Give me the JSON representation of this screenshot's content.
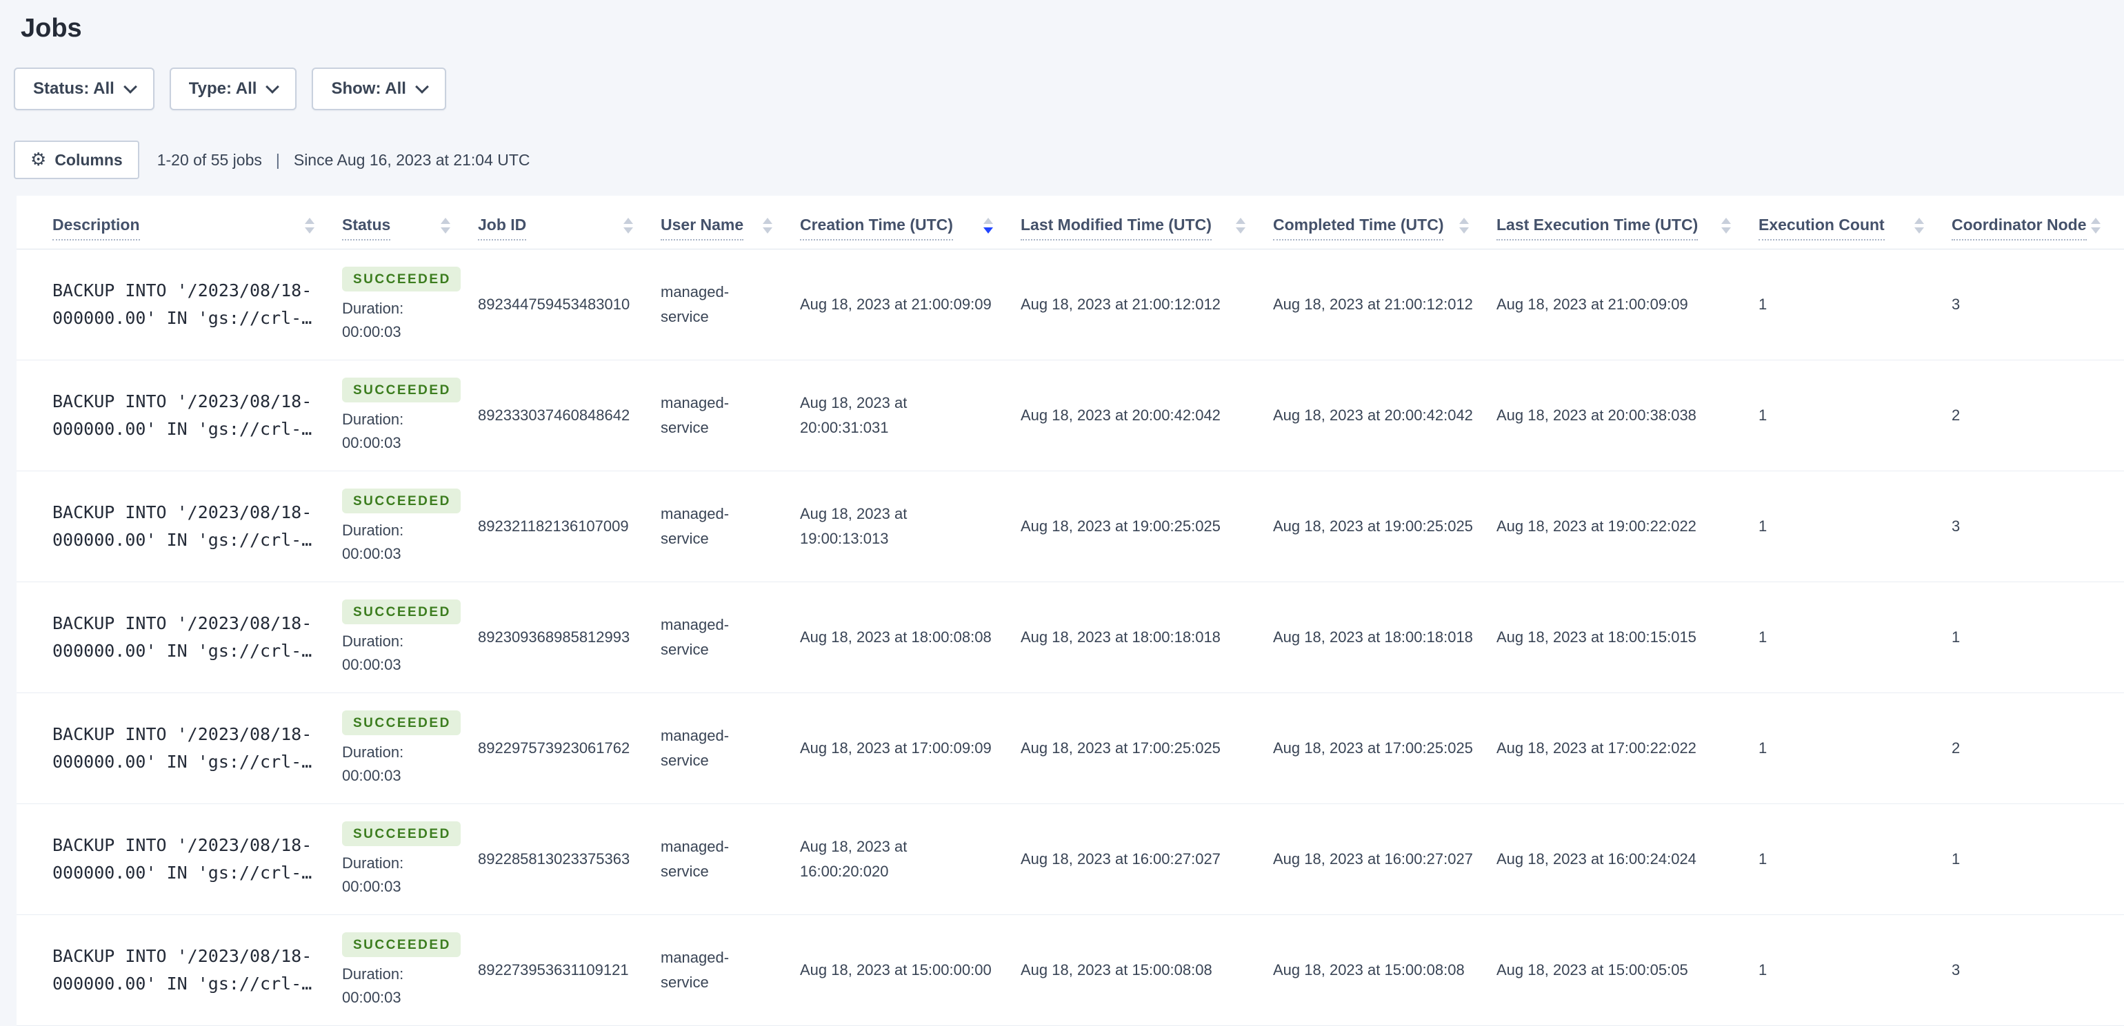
{
  "page": {
    "title": "Jobs"
  },
  "filters": [
    {
      "label": "Status: All"
    },
    {
      "label": "Type: All"
    },
    {
      "label": "Show: All"
    }
  ],
  "toolbar": {
    "columns_label": "Columns",
    "results_count": "1-20 of 55 jobs",
    "separator": "|",
    "since": "Since Aug 16, 2023 at 21:04 UTC"
  },
  "colors": {
    "accent_sort_blue": "#2145ff",
    "badge_bg": "#e4f1dd",
    "badge_text": "#3c7d1f",
    "page_bg": "#f4f6fa"
  },
  "table": {
    "columns": [
      {
        "label": "Description",
        "sort": "none"
      },
      {
        "label": "Status",
        "sort": "none"
      },
      {
        "label": "Job ID",
        "sort": "none"
      },
      {
        "label": "User Name",
        "sort": "none"
      },
      {
        "label": "Creation Time (UTC)",
        "sort": "desc"
      },
      {
        "label": "Last Modified Time (UTC)",
        "sort": "none"
      },
      {
        "label": "Completed Time (UTC)",
        "sort": "none"
      },
      {
        "label": "Last Execution Time (UTC)",
        "sort": "none"
      },
      {
        "label": "Execution Count",
        "sort": "none"
      },
      {
        "label": "Coordinator Node",
        "sort": "none"
      }
    ],
    "rows": [
      {
        "description_lines": [
          "BACKUP INTO '/2023/08/18-",
          "000000.00' IN 'gs://crl-…"
        ],
        "status": "SUCCEEDED",
        "duration_label": "Duration:",
        "duration": "00:00:03",
        "job_id": "892344759453483010",
        "user_name": "managed-service",
        "creation_time": "Aug 18, 2023 at 21:00:09:09",
        "last_modified_time": "Aug 18, 2023 at 21:00:12:012",
        "completed_time": "Aug 18, 2023 at 21:00:12:012",
        "last_execution_time": "Aug 18, 2023 at 21:00:09:09",
        "execution_count": "1",
        "coordinator_node": "3"
      },
      {
        "description_lines": [
          "BACKUP INTO '/2023/08/18-",
          "000000.00' IN 'gs://crl-…"
        ],
        "status": "SUCCEEDED",
        "duration_label": "Duration:",
        "duration": "00:00:03",
        "job_id": "892333037460848642",
        "user_name": "managed-service",
        "creation_time": "Aug 18, 2023 at 20:00:31:031",
        "last_modified_time": "Aug 18, 2023 at 20:00:42:042",
        "completed_time": "Aug 18, 2023 at 20:00:42:042",
        "last_execution_time": "Aug 18, 2023 at 20:00:38:038",
        "execution_count": "1",
        "coordinator_node": "2"
      },
      {
        "description_lines": [
          "BACKUP INTO '/2023/08/18-",
          "000000.00' IN 'gs://crl-…"
        ],
        "status": "SUCCEEDED",
        "duration_label": "Duration:",
        "duration": "00:00:03",
        "job_id": "892321182136107009",
        "user_name": "managed-service",
        "creation_time": "Aug 18, 2023 at 19:00:13:013",
        "last_modified_time": "Aug 18, 2023 at 19:00:25:025",
        "completed_time": "Aug 18, 2023 at 19:00:25:025",
        "last_execution_time": "Aug 18, 2023 at 19:00:22:022",
        "execution_count": "1",
        "coordinator_node": "3"
      },
      {
        "description_lines": [
          "BACKUP INTO '/2023/08/18-",
          "000000.00' IN 'gs://crl-…"
        ],
        "status": "SUCCEEDED",
        "duration_label": "Duration:",
        "duration": "00:00:03",
        "job_id": "892309368985812993",
        "user_name": "managed-service",
        "creation_time": "Aug 18, 2023 at 18:00:08:08",
        "last_modified_time": "Aug 18, 2023 at 18:00:18:018",
        "completed_time": "Aug 18, 2023 at 18:00:18:018",
        "last_execution_time": "Aug 18, 2023 at 18:00:15:015",
        "execution_count": "1",
        "coordinator_node": "1"
      },
      {
        "description_lines": [
          "BACKUP INTO '/2023/08/18-",
          "000000.00' IN 'gs://crl-…"
        ],
        "status": "SUCCEEDED",
        "duration_label": "Duration:",
        "duration": "00:00:03",
        "job_id": "892297573923061762",
        "user_name": "managed-service",
        "creation_time": "Aug 18, 2023 at 17:00:09:09",
        "last_modified_time": "Aug 18, 2023 at 17:00:25:025",
        "completed_time": "Aug 18, 2023 at 17:00:25:025",
        "last_execution_time": "Aug 18, 2023 at 17:00:22:022",
        "execution_count": "1",
        "coordinator_node": "2"
      },
      {
        "description_lines": [
          "BACKUP INTO '/2023/08/18-",
          "000000.00' IN 'gs://crl-…"
        ],
        "status": "SUCCEEDED",
        "duration_label": "Duration:",
        "duration": "00:00:03",
        "job_id": "892285813023375363",
        "user_name": "managed-service",
        "creation_time": "Aug 18, 2023 at 16:00:20:020",
        "last_modified_time": "Aug 18, 2023 at 16:00:27:027",
        "completed_time": "Aug 18, 2023 at 16:00:27:027",
        "last_execution_time": "Aug 18, 2023 at 16:00:24:024",
        "execution_count": "1",
        "coordinator_node": "1"
      },
      {
        "description_lines": [
          "BACKUP INTO '/2023/08/18-",
          "000000.00' IN 'gs://crl-…"
        ],
        "status": "SUCCEEDED",
        "duration_label": "Duration:",
        "duration": "00:00:03",
        "job_id": "892273953631109121",
        "user_name": "managed-service",
        "creation_time": "Aug 18, 2023 at 15:00:00:00",
        "last_modified_time": "Aug 18, 2023 at 15:00:08:08",
        "completed_time": "Aug 18, 2023 at 15:00:08:08",
        "last_execution_time": "Aug 18, 2023 at 15:00:05:05",
        "execution_count": "1",
        "coordinator_node": "3"
      }
    ]
  }
}
